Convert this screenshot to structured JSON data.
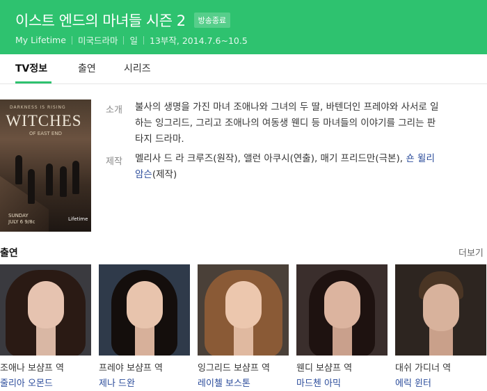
{
  "header": {
    "title": "이스트 엔드의 마녀들 시즌 2",
    "status_badge": "방송종료",
    "meta": [
      "My Lifetime",
      "미국드라마",
      "일",
      "13부작, 2014.7.6~10.5"
    ]
  },
  "tabs": [
    {
      "label": "TV정보",
      "active": true
    },
    {
      "label": "출연",
      "active": false
    },
    {
      "label": "시리즈",
      "active": false
    }
  ],
  "poster": {
    "tagline": "DARKNESS IS RISING",
    "title": "WITCHES",
    "subtitle": "OF EAST END",
    "date_line1": "SUNDAY",
    "date_line2": "JULY 6 9/8c",
    "logo": "Lifetime"
  },
  "info": {
    "intro_label": "소개",
    "intro_line1": "불사의 생명을 가진 마녀 조애나와 그녀의 두 딸, 바텐더인 프레야와 사서로 일",
    "intro_line2": "하는 잉그리드, 그리고 조애나의 여동생 웬디 등 마녀들의 이야기를 그리는 판",
    "intro_line3": "타지 드라마.",
    "credits_label": "제작",
    "credits_line1_text": "멜리사 드 라 크루즈(원작), 앨런 아쿠시(연출), 매기 프리드만(극본),",
    "credits_link_part1": "숀 윌리",
    "credits_link_part2": "암슨",
    "credits_line2_suffix": "(제작)"
  },
  "cast": {
    "heading": "출연",
    "more_label": "더보기",
    "members": [
      {
        "role": "조애나 보샴프 역",
        "actor": "줄리아 오몬드"
      },
      {
        "role": "프레야 보샴프 역",
        "actor": "제나 드완"
      },
      {
        "role": "잉그리드 보샴프 역",
        "actor": "레이첼 보스톤"
      },
      {
        "role": "웬디 보샴프 역",
        "actor": "마드첸 아믹"
      },
      {
        "role": "대쉬 가디너 역",
        "actor": "에릭 윈터"
      }
    ]
  },
  "colors": {
    "brand_green": "#2ec26f",
    "link_blue": "#2b4c9b"
  }
}
